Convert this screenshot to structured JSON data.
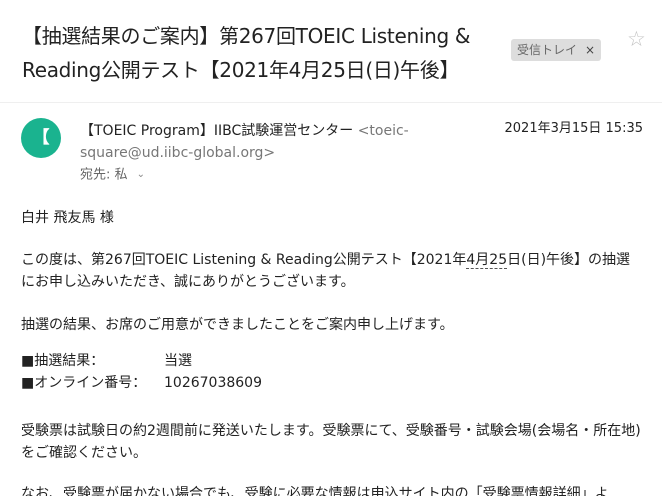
{
  "subject": "【抽選結果のご案内】第267回TOEIC Listening & Reading公開テスト【2021年4月25日(日)午後】",
  "label_chip": {
    "text": "受信トレイ",
    "close": "×"
  },
  "star": "☆",
  "sender": {
    "avatar_letter": "【",
    "avatar_color": "#1ab38f",
    "name": "【TOEIC Program】IIBC試験運営センター",
    "email": "<toeic-square@ud.iibc-global.org>",
    "date": "2021年3月15日 15:35",
    "to": "宛先: 私",
    "to_caret": "⌄"
  },
  "body": {
    "greeting": "白井 飛友馬 様",
    "para1_pre": "この度は、第267回TOEIC Listening & Reading公開テスト【2021年",
    "para1_date": "4月25",
    "para1_post": "日(日)午後】の抽選にお申し込みいただき、誠にありがとうございます。",
    "para2": "抽選の結果、お席のご用意ができましたことをご案内申し上げます。",
    "result_label": "■抽選結果：",
    "result_value": "当選",
    "online_label": "■オンライン番号：",
    "online_value": "10267038609",
    "para3": "受験票は試験日の約2週間前に発送いたします。受験票にて、受験番号・試験会場(会場名・所在地)をご確認ください。",
    "para4": "なお、受験票が届かない場合でも、受験に必要な情報は申込サイト内の「受験票情報詳細」よ"
  }
}
